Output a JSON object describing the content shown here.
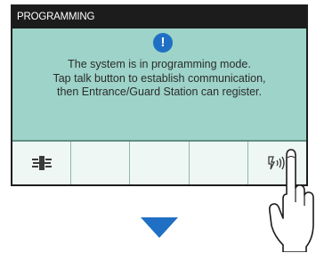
{
  "screen": {
    "title": "PROGRAMMING",
    "message_lines": [
      "The system is in programming mode.",
      "Tap talk button to establish communication,",
      "then Entrance/Guard Station can register."
    ]
  },
  "icons": {
    "alert": "exclamation-circle-icon",
    "transfer": "transfer-icon",
    "talk": "talk-icon",
    "hand": "hand-pointer-icon",
    "arrow": "arrow-down-icon"
  },
  "colors": {
    "screen_bg": "#9dd3c8",
    "title_bar": "#1c1c1c",
    "accent_blue": "#1f6fc4",
    "softkey_bg": "#eef7f4"
  },
  "alert_glyph": "!"
}
